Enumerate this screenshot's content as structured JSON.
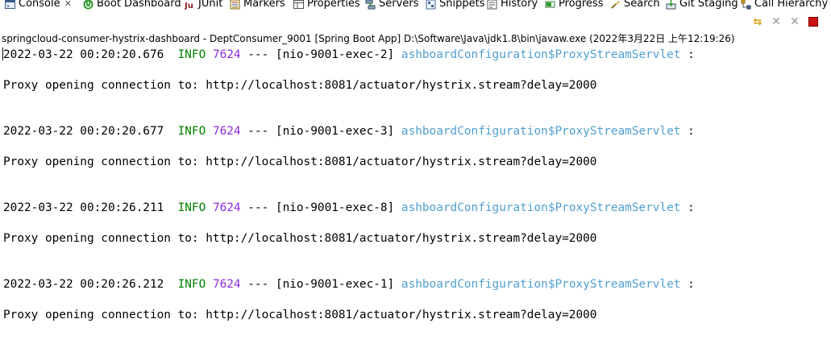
{
  "tabs": [
    {
      "id": "console",
      "label": "Console",
      "icon": "console-icon",
      "active": true,
      "closable": true
    },
    {
      "id": "boot-dashboard",
      "label": "Boot Dashboard",
      "icon": "power-icon"
    },
    {
      "id": "junit",
      "label": "JUnit",
      "icon": "junit-icon"
    },
    {
      "id": "markers",
      "label": "Markers",
      "icon": "markers-icon"
    },
    {
      "id": "properties",
      "label": "Properties",
      "icon": "properties-icon"
    },
    {
      "id": "servers",
      "label": "Servers",
      "icon": "servers-icon"
    },
    {
      "id": "snippets",
      "label": "Snippets",
      "icon": "snippets-icon"
    },
    {
      "id": "history",
      "label": "History",
      "icon": "history-icon"
    },
    {
      "id": "progress",
      "label": "Progress",
      "icon": "progress-icon"
    },
    {
      "id": "search",
      "label": "Search",
      "icon": "search-icon"
    },
    {
      "id": "git-staging",
      "label": "Git Staging",
      "icon": "git-staging-icon"
    },
    {
      "id": "call-hierarchy",
      "label": "Call Hierarchy",
      "icon": "call-hierarchy-icon"
    }
  ],
  "tab_close_glyph": "✕",
  "toolbar": {
    "buttons": [
      {
        "name": "pin-console-icon",
        "glyph": "⇆"
      },
      {
        "name": "remove-launch-icon",
        "glyph": "✕"
      },
      {
        "name": "remove-all-terminated-icon",
        "glyph": "✕"
      },
      {
        "name": "terminate-icon",
        "glyph": ""
      }
    ]
  },
  "process_description": "springcloud-consumer-hystrix-dashboard - DeptConsumer_9001 [Spring Boot App] D:\\Software\\Java\\jdk1.8\\bin\\javaw.exe  (2022年3月22日 上午12:19:26)",
  "colors": {
    "level": "#008000",
    "pid": "#8a2be2",
    "logger": "#4f9fcf",
    "stop": "#cc1111"
  },
  "console": {
    "entries": [
      {
        "timestamp": "2022-03-22 00:20:20.676",
        "level": "INFO",
        "pid": "7624",
        "separator": "---",
        "thread": "[nio-9001-exec-2]",
        "logger": "ashboardConfiguration$ProxyStreamServlet",
        "colon": ":",
        "message": "Proxy opening connection to: http://localhost:8081/actuator/hystrix.stream?delay=2000"
      },
      {
        "timestamp": "2022-03-22 00:20:20.677",
        "level": "INFO",
        "pid": "7624",
        "separator": "---",
        "thread": "[nio-9001-exec-3]",
        "logger": "ashboardConfiguration$ProxyStreamServlet",
        "colon": ":",
        "message": "Proxy opening connection to: http://localhost:8081/actuator/hystrix.stream?delay=2000"
      },
      {
        "timestamp": "2022-03-22 00:20:26.211",
        "level": "INFO",
        "pid": "7624",
        "separator": "---",
        "thread": "[nio-9001-exec-8]",
        "logger": "ashboardConfiguration$ProxyStreamServlet",
        "colon": ":",
        "message": "Proxy opening connection to: http://localhost:8081/actuator/hystrix.stream?delay=2000"
      },
      {
        "timestamp": "2022-03-22 00:20:26.212",
        "level": "INFO",
        "pid": "7624",
        "separator": "---",
        "thread": "[nio-9001-exec-1]",
        "logger": "ashboardConfiguration$ProxyStreamServlet",
        "colon": ":",
        "message": "Proxy opening connection to: http://localhost:8081/actuator/hystrix.stream?delay=2000"
      }
    ]
  }
}
